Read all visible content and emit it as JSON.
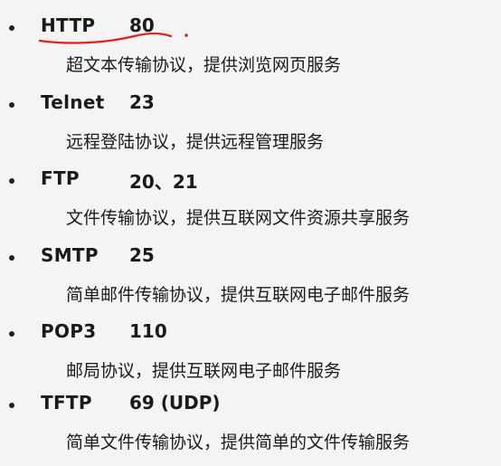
{
  "protocols": [
    {
      "name": "HTTP",
      "port": "80",
      "description": "超文本传输协议，提供浏览网页服务"
    },
    {
      "name": "Telnet",
      "port": "23",
      "description": "远程登陆协议，提供远程管理服务"
    },
    {
      "name": "FTP",
      "port": "20、21",
      "description": "文件传输协议，提供互联网文件资源共享服务"
    },
    {
      "name": "SMTP",
      "port": "25",
      "description": "简单邮件传输协议，提供互联网电子邮件服务"
    },
    {
      "name": "POP3",
      "port": "110",
      "description": "邮局协议，提供互联网电子邮件服务"
    },
    {
      "name": "TFTP",
      "port": "69 (UDP)",
      "description": "简单文件传输协议，提供简单的文件传输服务"
    }
  ],
  "annotation": {
    "color": "#e0201a"
  }
}
